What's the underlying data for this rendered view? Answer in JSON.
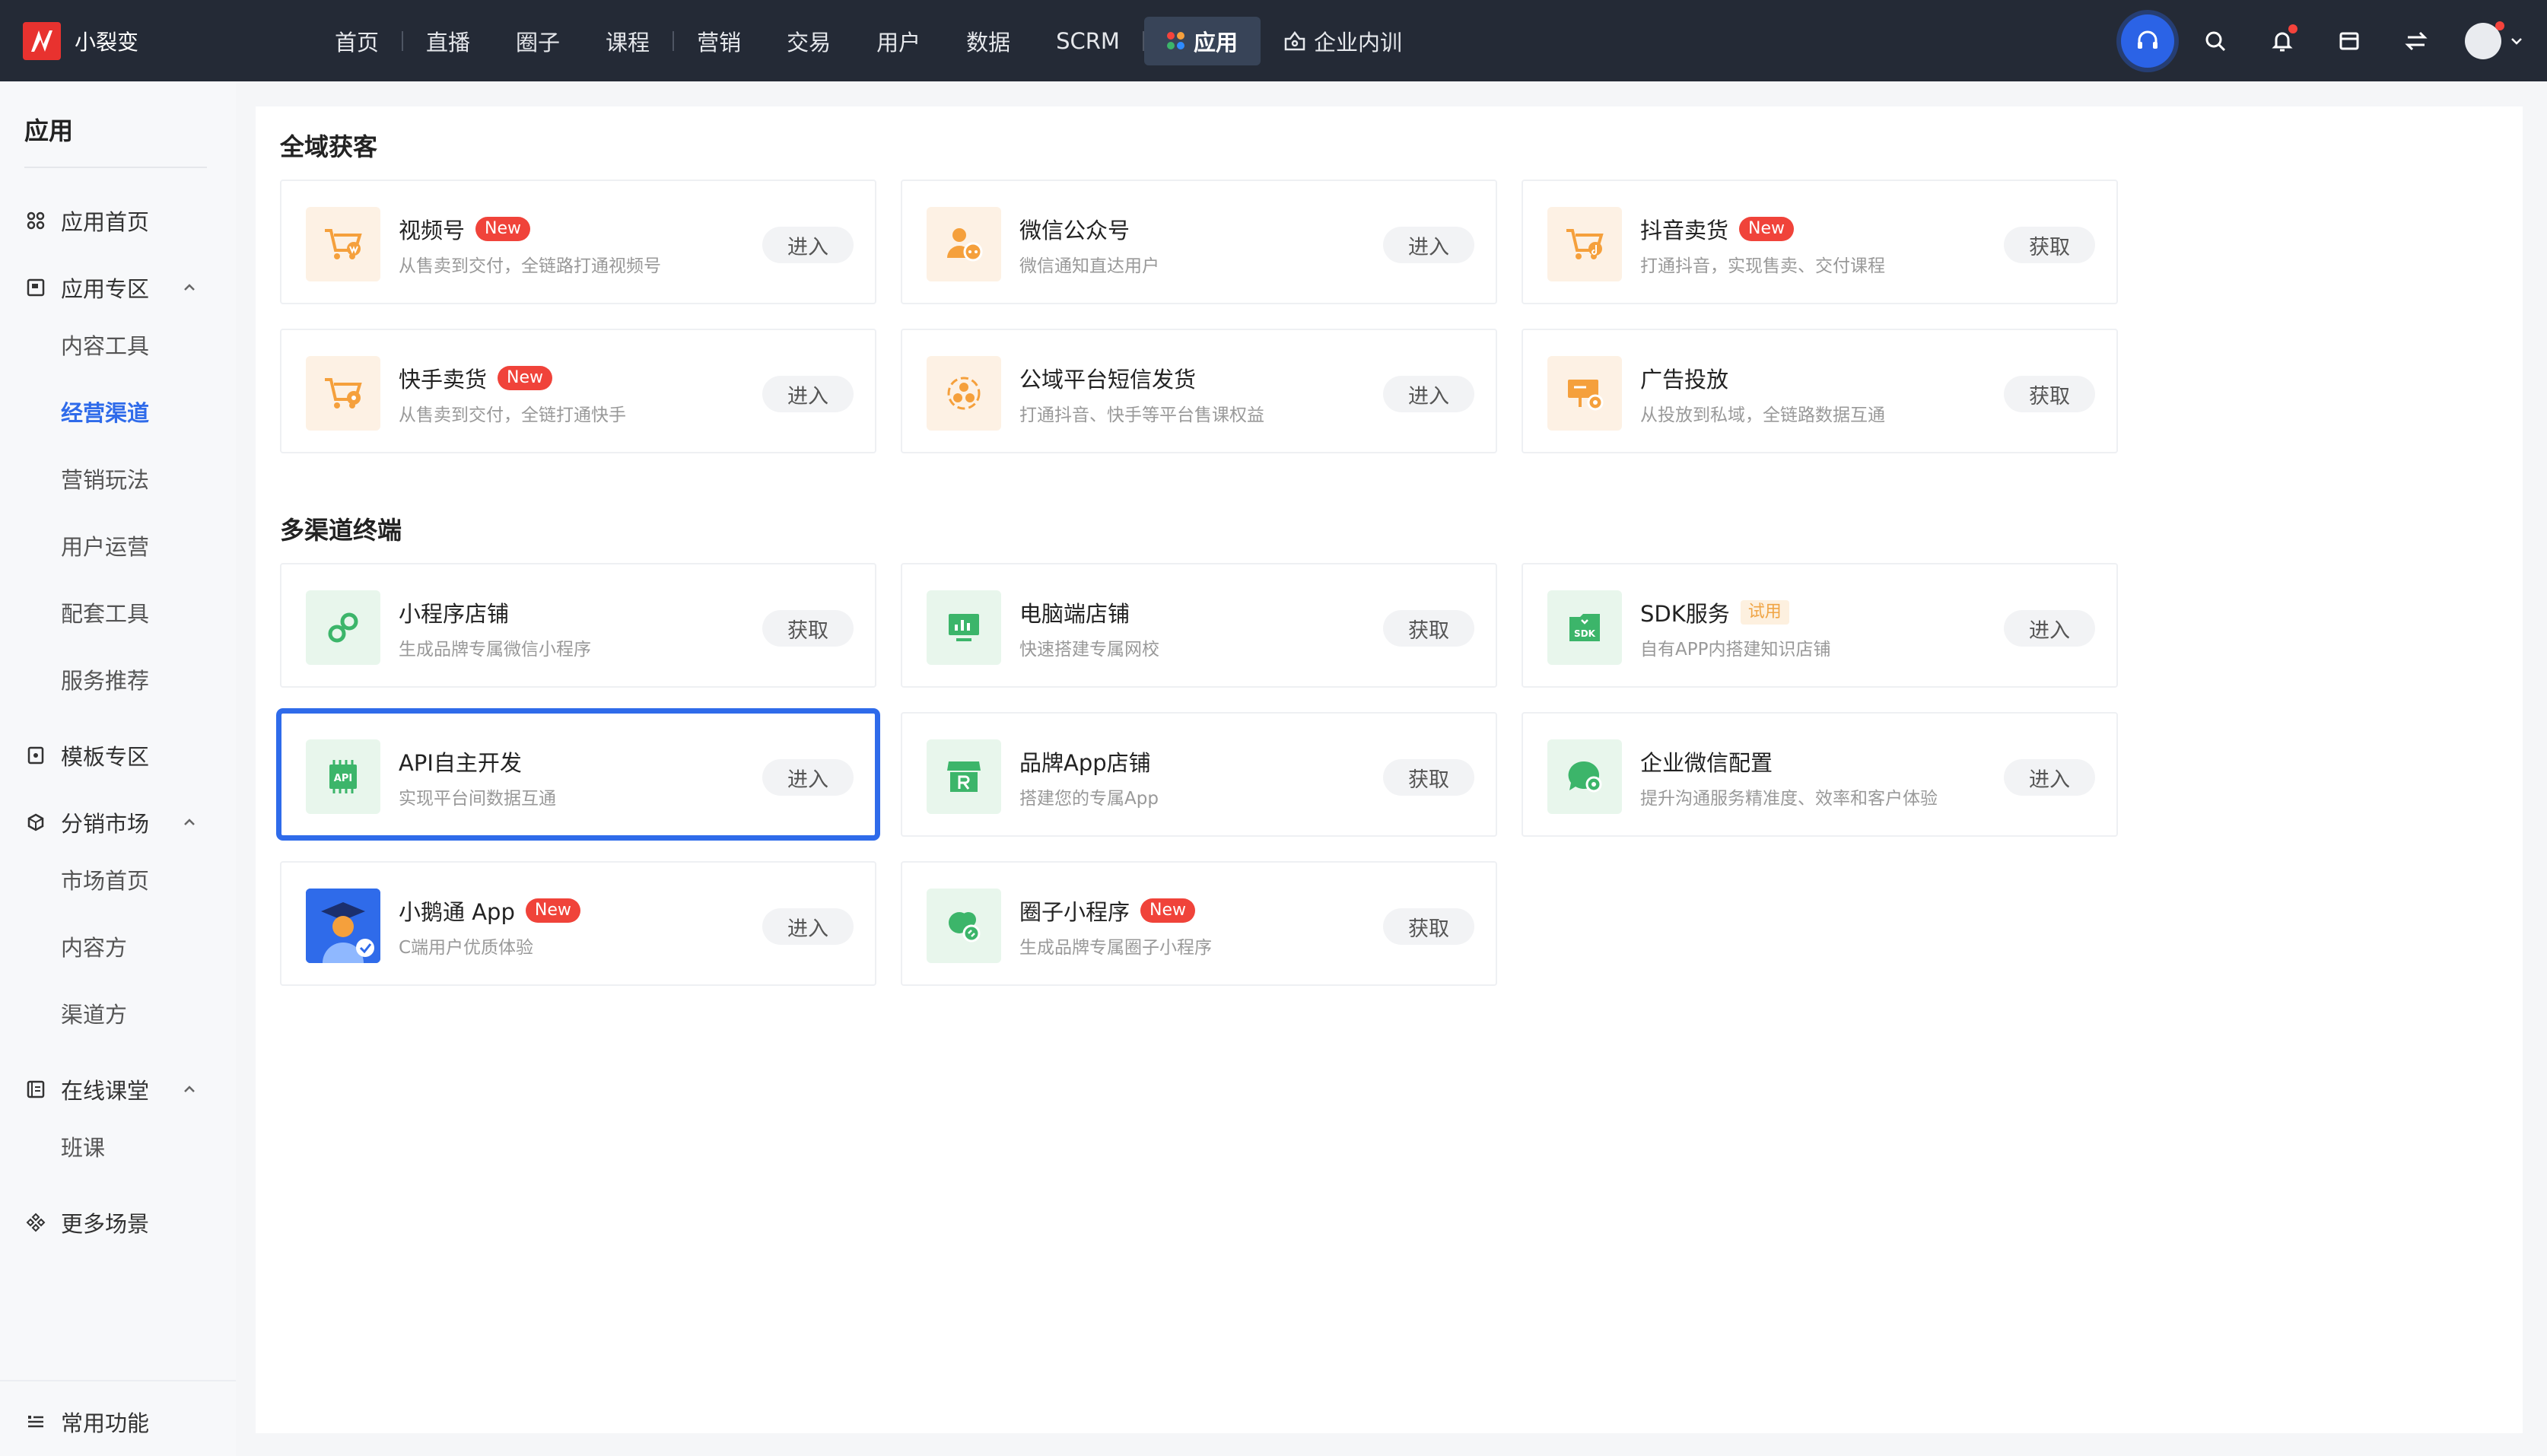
{
  "brand": {
    "name": "小裂变",
    "logo_color": "#e8322f"
  },
  "topnav": {
    "items": [
      "首页",
      "直播",
      "圈子",
      "课程",
      "营销",
      "交易",
      "用户",
      "数据",
      "SCRM"
    ],
    "active": "应用",
    "training": "企业内训",
    "bg_color": "#242a36"
  },
  "sidebar": {
    "title": "应用",
    "home": "应用首页",
    "zone": "应用专区",
    "zone_subs": [
      "内容工具",
      "经营渠道",
      "营销玩法",
      "用户运营",
      "配套工具",
      "服务推荐"
    ],
    "template": "模板专区",
    "distribution": "分销市场",
    "distribution_subs": [
      "市场首页",
      "内容方",
      "渠道方"
    ],
    "classroom": "在线课堂",
    "classroom_subs": [
      "班课"
    ],
    "more": "更多场景",
    "common": "常用功能"
  },
  "sections": {
    "acquisition": {
      "title": "全域获客",
      "cards": [
        {
          "name": "视频号",
          "badge": "New",
          "desc": "从售卖到交付，全链路打通视频号",
          "button": "进入"
        },
        {
          "name": "微信公众号",
          "badge": "",
          "desc": "微信通知直达用户",
          "button": "进入"
        },
        {
          "name": "抖音卖货",
          "badge": "New",
          "desc": "打通抖音，实现售卖、交付课程",
          "button": "获取"
        },
        {
          "name": "快手卖货",
          "badge": "New",
          "desc": "从售卖到交付，全链打通快手",
          "button": "进入"
        },
        {
          "name": "公域平台短信发货",
          "badge": "",
          "desc": "打通抖音、快手等平台售课权益",
          "button": "进入"
        },
        {
          "name": "广告投放",
          "badge": "",
          "desc": "从投放到私域，全链路数据互通",
          "button": "获取"
        }
      ]
    },
    "terminals": {
      "title": "多渠道终端",
      "cards": [
        {
          "name": "小程序店铺",
          "badge": "",
          "desc": "生成品牌专属微信小程序",
          "button": "获取"
        },
        {
          "name": "电脑端店铺",
          "badge": "",
          "desc": "快速搭建专属网校",
          "button": "获取"
        },
        {
          "name": "SDK服务",
          "badge": "试用",
          "desc": "自有APP内搭建知识店铺",
          "button": "进入"
        },
        {
          "name": "API自主开发",
          "badge": "",
          "desc": "实现平台间数据互通",
          "button": "进入"
        },
        {
          "name": "品牌App店铺",
          "badge": "",
          "desc": "搭建您的专属App",
          "button": "获取"
        },
        {
          "name": "企业微信配置",
          "badge": "",
          "desc": "提升沟通服务精准度、效率和客户体验",
          "button": "进入"
        },
        {
          "name": "小鹅通 App",
          "badge": "New",
          "desc": "C端用户优质体验",
          "button": "进入"
        },
        {
          "name": "圈子小程序",
          "badge": "New",
          "desc": "生成品牌专属圈子小程序",
          "button": "获取"
        }
      ]
    }
  },
  "icons": {
    "sdk_label": "SDK",
    "api_label": "API"
  },
  "colors": {
    "accent": "#2f6bea",
    "new_badge": "#f0433a",
    "icon_orange": "#f5a03c",
    "icon_green": "#3cb56a"
  }
}
